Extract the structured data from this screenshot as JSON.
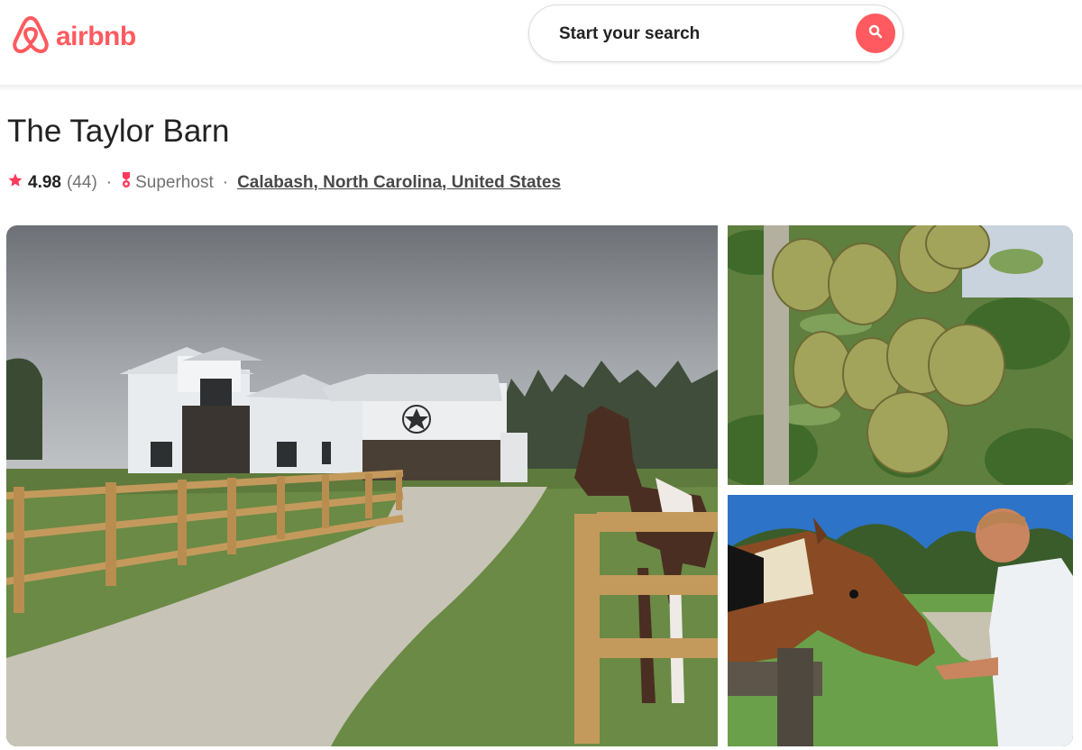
{
  "header": {
    "logo_text": "airbnb",
    "search_placeholder": "Start your search"
  },
  "listing": {
    "title": "The Taylor Barn",
    "rating": "4.98",
    "review_count": "(44)",
    "superhost_label": "Superhost",
    "separator": "·",
    "location": "Calabash, North Carolina, United States"
  },
  "gallery": {
    "photos": [
      {
        "subject": "white barn with horse and wooden fence"
      },
      {
        "subject": "pears on tree"
      },
      {
        "subject": "man feeding horse"
      }
    ]
  },
  "colors": {
    "brand": "#ff5a5f",
    "star": "#ff385c"
  },
  "icons": {
    "logo": "airbnb-belo-icon",
    "search": "search-icon",
    "rating": "star-icon",
    "superhost": "superhost-badge-icon"
  }
}
